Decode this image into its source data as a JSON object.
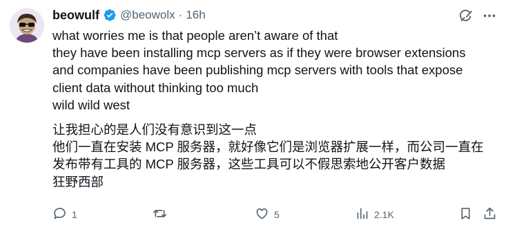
{
  "post": {
    "author": {
      "name": "beowulf",
      "handle": "@beowolx",
      "separator": "·",
      "time": "16h",
      "verified": true
    },
    "text_en": "what worries me is that people aren’t aware of that\nthey have been installing mcp servers as if they were browser extensions\nand companies have been publishing mcp servers with tools that expose\nclient data without thinking too much\nwild wild west",
    "text_zh": "让我担心的是人们没有意识到这一点\n他们一直在安装 MCP 服务器，就好像它们是浏览器扩展一样，而公司一直在\n发布带有工具的 MCP 服务器，这些工具可以不假思索地公开客户数据\n狂野西部"
  },
  "actions": {
    "replies": "1",
    "reposts": "",
    "likes": "5",
    "views": "2.1K"
  },
  "icons": {
    "verified": "verified-badge-icon",
    "grok": "grok-icon",
    "more": "more-options-icon",
    "reply": "reply-icon",
    "repost": "repost-icon",
    "like": "like-icon",
    "views": "views-icon",
    "bookmark": "bookmark-icon",
    "share": "share-icon"
  },
  "colors": {
    "text": "#0f1419",
    "secondary": "#536471",
    "verified": "#1d9bf0"
  }
}
